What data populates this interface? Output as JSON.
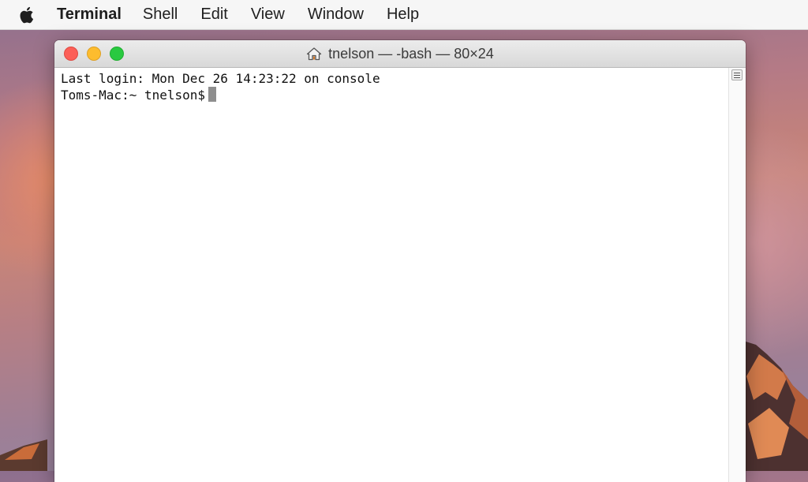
{
  "menubar": {
    "apple_icon": "apple-logo-icon",
    "app_name": "Terminal",
    "items": [
      "Shell",
      "Edit",
      "View",
      "Window",
      "Help"
    ]
  },
  "window": {
    "title": "tnelson — -bash — 80×24",
    "title_icon": "home-icon",
    "traffic_lights": {
      "close_color": "#fc5f57",
      "minimize_color": "#fdbc2e",
      "zoom_color": "#29c940"
    },
    "terminal": {
      "lines": [
        "Last login: Mon Dec 26 14:23:22 on console",
        "Toms-Mac:~ tnelson$"
      ]
    }
  }
}
